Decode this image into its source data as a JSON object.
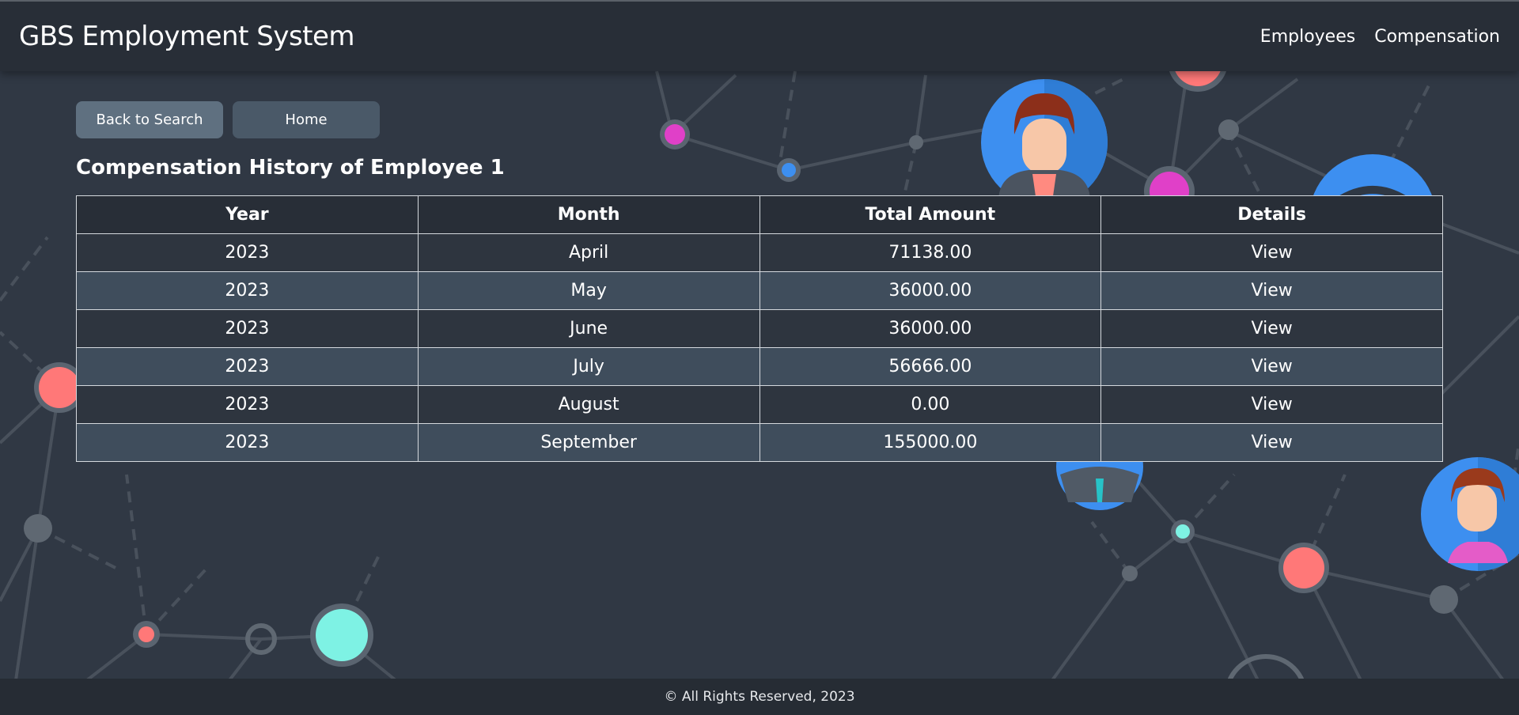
{
  "header": {
    "brand": "GBS Employment System",
    "nav": [
      "Employees",
      "Compensation"
    ]
  },
  "actions": {
    "back": "Back to Search",
    "home": "Home"
  },
  "page_title": "Compensation History of Employee 1",
  "table": {
    "headers": [
      "Year",
      "Month",
      "Total Amount",
      "Details"
    ],
    "rows": [
      [
        "2023",
        "April",
        "71138.00",
        "View"
      ],
      [
        "2023",
        "May",
        "36000.00",
        "View"
      ],
      [
        "2023",
        "June",
        "36000.00",
        "View"
      ],
      [
        "2023",
        "July",
        "56666.00",
        "View"
      ],
      [
        "2023",
        "August",
        "0.00",
        "View"
      ],
      [
        "2023",
        "September",
        "155000.00",
        "View"
      ]
    ]
  },
  "footer": "© All Rights Reserved, 2023",
  "colors": {
    "background": "#303844",
    "navbar": "#282e37",
    "row_alt": "#3f4d5c",
    "node_pink": "#e040c8",
    "node_coral": "#ff7878",
    "node_cyan": "#7ef2e4",
    "node_blue": "#3d8ff0"
  }
}
